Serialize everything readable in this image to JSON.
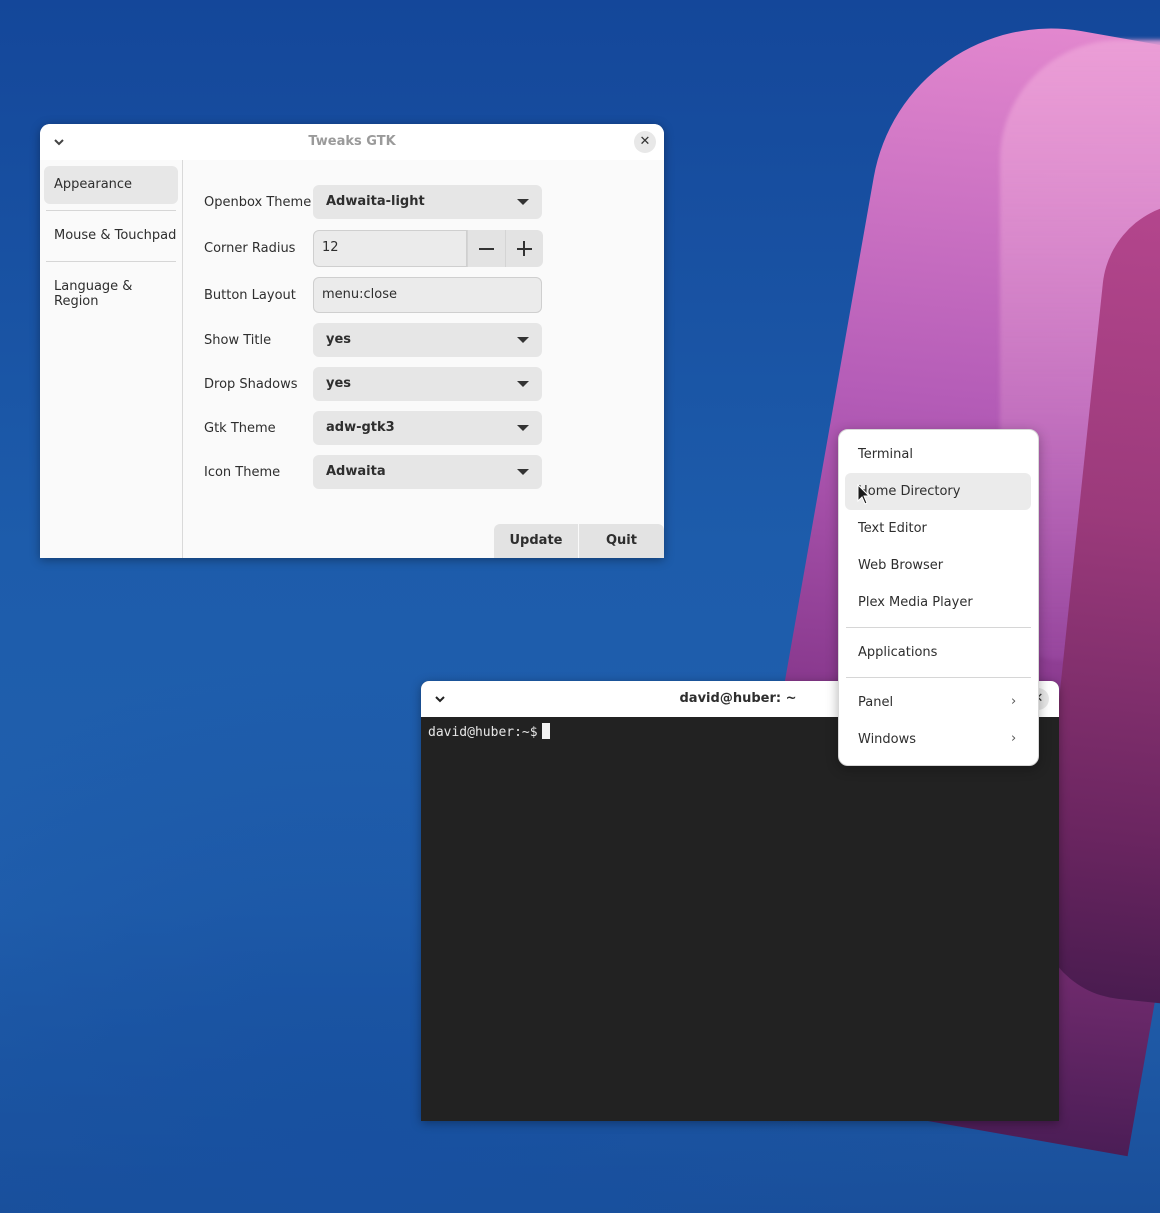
{
  "tweaks": {
    "title": "Tweaks GTK",
    "sidebar": [
      {
        "label": "Appearance",
        "active": true
      },
      {
        "label": "Mouse & Touchpad",
        "active": false
      },
      {
        "label": "Language & Region",
        "active": false
      }
    ],
    "fields": {
      "openbox_theme": {
        "label": "Openbox Theme",
        "value": "Adwaita-light"
      },
      "corner_radius": {
        "label": "Corner Radius",
        "value": "12"
      },
      "button_layout": {
        "label": "Button Layout",
        "value": "menu:close"
      },
      "show_title": {
        "label": "Show Title",
        "value": "yes"
      },
      "drop_shadows": {
        "label": "Drop Shadows",
        "value": "yes"
      },
      "gtk_theme": {
        "label": "Gtk Theme",
        "value": "adw-gtk3"
      },
      "icon_theme": {
        "label": "Icon Theme",
        "value": "Adwaita"
      }
    },
    "buttons": {
      "update": "Update",
      "quit": "Quit"
    }
  },
  "menu": {
    "items": [
      {
        "label": "Terminal"
      },
      {
        "label": "Home Directory",
        "hover": true
      },
      {
        "label": "Text Editor"
      },
      {
        "label": "Web Browser"
      },
      {
        "label": "Plex Media Player"
      },
      {
        "label": "Applications"
      },
      {
        "label": "Panel",
        "submenu": "›"
      },
      {
        "label": "Windows",
        "submenu": "›"
      }
    ]
  },
  "terminal": {
    "title": "david@huber: ~",
    "prompt": "david@huber:~$"
  },
  "colors": {
    "desktop": "#1f58a5",
    "terminal_bg": "#222222",
    "accent_pink": "#e489cf"
  },
  "icons": {
    "window_menu": "chevron-down-icon",
    "window_close": "close-icon",
    "spin_minus": "minus-icon",
    "spin_plus": "plus-icon",
    "combo_arrow": "triangle-down-icon",
    "pointer": "mouse-pointer-icon"
  }
}
